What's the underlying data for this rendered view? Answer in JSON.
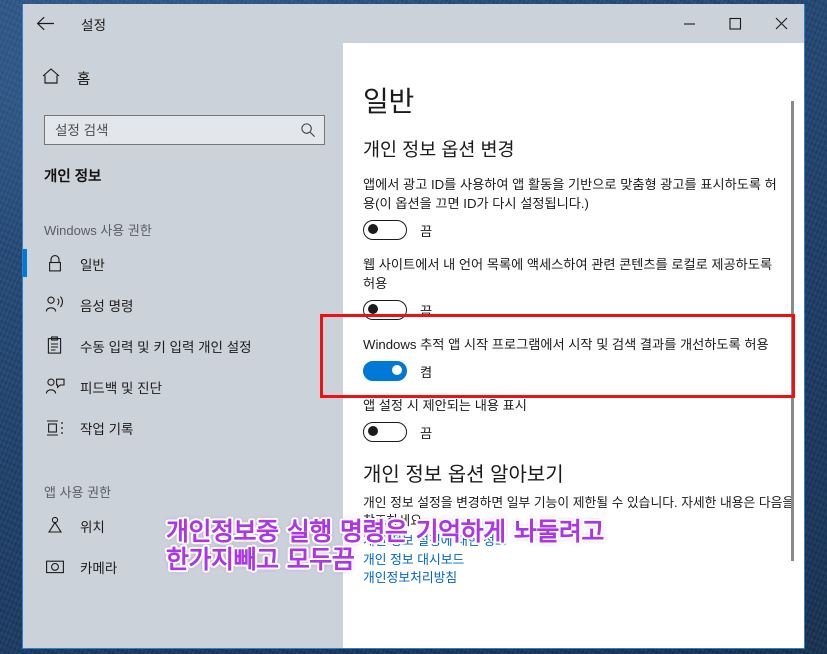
{
  "window": {
    "title": "설정",
    "back_icon": "back-arrow-icon",
    "controls": {
      "minimize": "minimize-icon",
      "maximize": "maximize-icon",
      "close": "close-icon"
    }
  },
  "sidebar": {
    "home_label": "홈",
    "home_icon": "home-icon",
    "search": {
      "placeholder": "설정 검색",
      "value": "",
      "icon": "search-icon"
    },
    "category": "개인 정보",
    "groups": [
      {
        "title": "Windows 사용 권한",
        "items": [
          {
            "label": "일반",
            "icon": "lock-icon",
            "selected": true
          },
          {
            "label": "음성 명령",
            "icon": "voice-icon",
            "selected": false
          },
          {
            "label": "수동 입력 및 키 입력 개인 설정",
            "icon": "clipboard-icon",
            "selected": false
          },
          {
            "label": "피드백 및 진단",
            "icon": "feedback-icon",
            "selected": false
          },
          {
            "label": "작업 기록",
            "icon": "activity-history-icon",
            "selected": false
          }
        ]
      },
      {
        "title": "앱 사용 권한",
        "items": [
          {
            "label": "위치",
            "icon": "location-icon",
            "selected": false
          },
          {
            "label": "카메라",
            "icon": "camera-icon",
            "selected": false
          }
        ]
      }
    ]
  },
  "main": {
    "page_title": "일반",
    "section_title": "개인 정보 옵션 변경",
    "options": [
      {
        "description": "앱에서 광고 ID를 사용하여 앱 활동을 기반으로 맞춤형 광고를 표시하도록 허용(이 옵션을 끄면 ID가 다시 설정됩니다.)",
        "toggle_state": "off",
        "toggle_label": "끔"
      },
      {
        "description": "웹 사이트에서 내 언어 목록에 액세스하여 관련 콘텐츠를 로컬로 제공하도록 허용",
        "toggle_state": "off",
        "toggle_label": "끔"
      },
      {
        "description": "Windows 추적 앱 시작 프로그램에서 시작 및 검색 결과를 개선하도록 허용",
        "toggle_state": "on",
        "toggle_label": "켬",
        "highlighted": true
      },
      {
        "description": "앱 설정 시 제안되는 내용 표시",
        "toggle_state": "off",
        "toggle_label": "끔"
      }
    ],
    "learn_more": {
      "title": "개인 정보 옵션 알아보기",
      "body": "개인 정보 설정을 변경하면 일부 기능이 제한될 수 있습니다. 자세한 내용은 다음을 참조하세요.",
      "links": [
        "개인 정보 설정에 대한 정보",
        "개인 정보 대시보드",
        "개인정보처리방침"
      ]
    }
  },
  "annotation": {
    "line1": "개인정보중 실행 명령은 기억하게 놔둘려고",
    "line2": "한가지빼고 모두끔",
    "color": "#ab35e8"
  },
  "highlight": {
    "color": "#ee1111"
  }
}
